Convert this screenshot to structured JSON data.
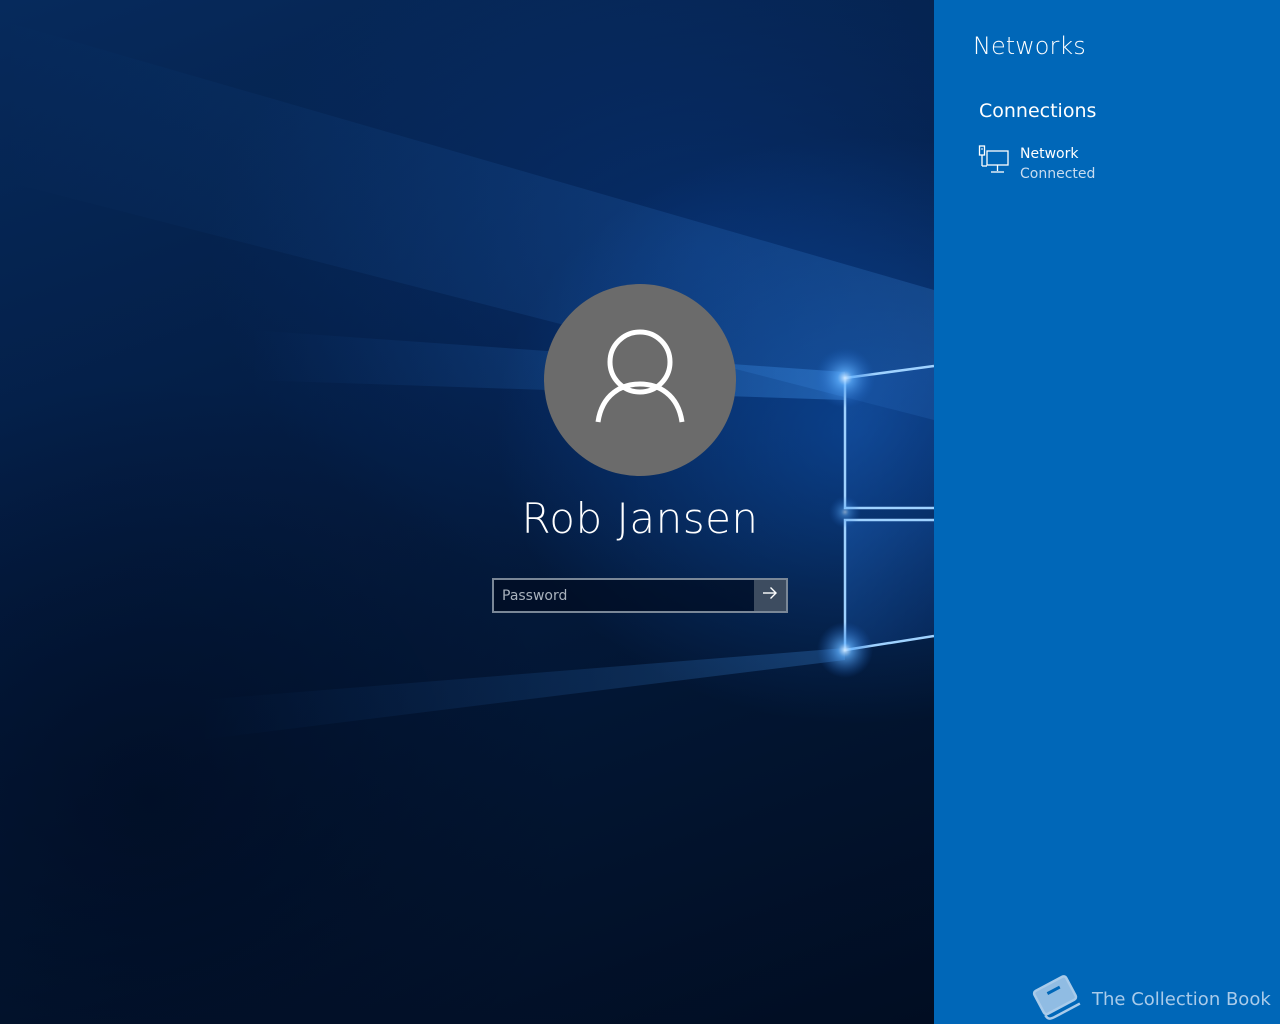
{
  "login": {
    "user_name": "Rob Jansen",
    "password_placeholder": "Password",
    "password_value": "",
    "avatar_icon": "user-silhouette-icon",
    "submit_icon": "arrow-right-icon"
  },
  "flyout": {
    "title": "Networks",
    "section_heading": "Connections",
    "connections": [
      {
        "name": "Network",
        "status": "Connected",
        "icon": "wired-network-icon"
      }
    ]
  },
  "watermark": {
    "text": "The Collection Book",
    "icon": "book-icon"
  },
  "colors": {
    "flyout_background": "#0067b8",
    "avatar_background": "#6b6b6b",
    "wallpaper_dark": "#02142f"
  }
}
